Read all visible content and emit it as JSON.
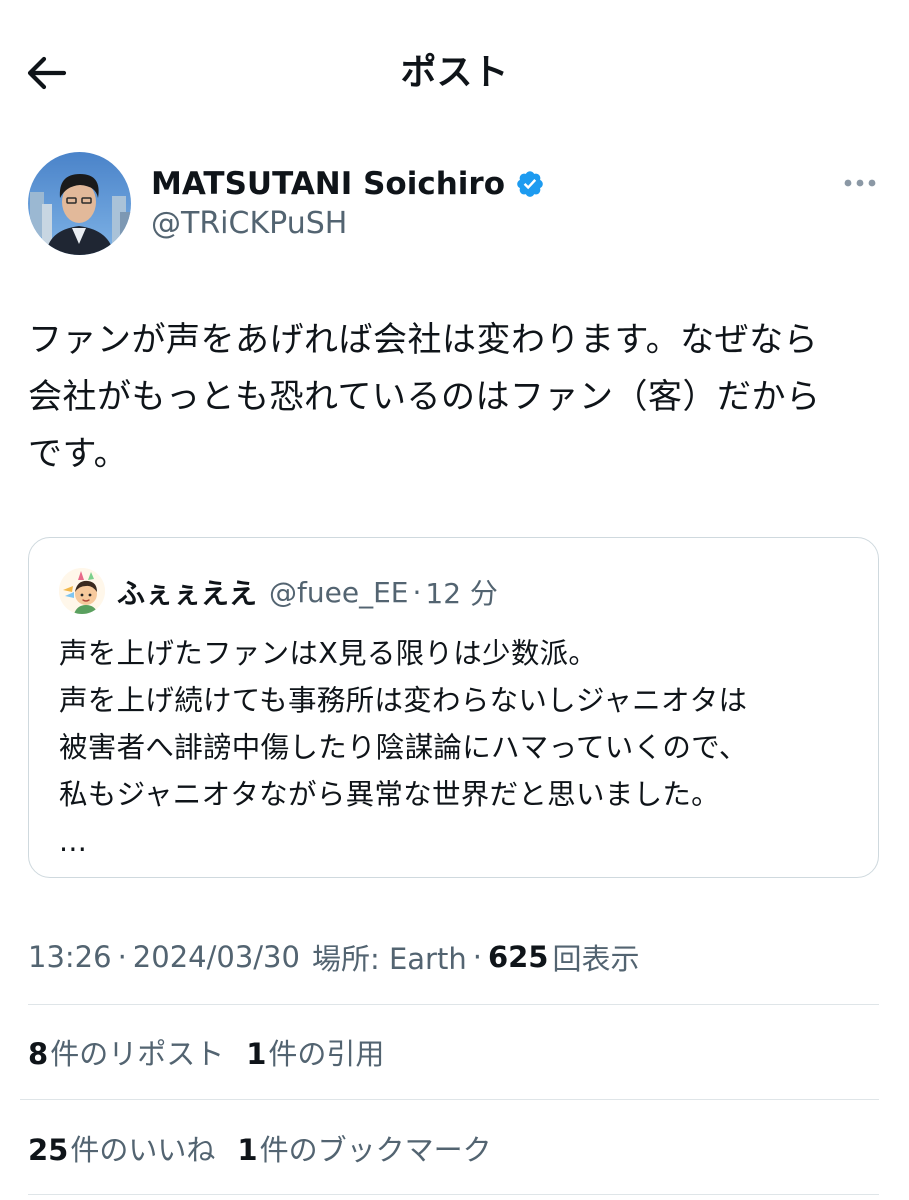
{
  "header": {
    "title": "ポスト"
  },
  "post": {
    "author_name": "MATSUTANI Soichiro",
    "author_handle": "@TRiCKPuSH",
    "text": "ファンが声をあげれば会社は変わります。なぜなら\n会社がもっとも恐れているのはファン（客）だから\nです。"
  },
  "quote": {
    "name": "ふぇぇええ",
    "handle": "@fuee_EE",
    "separator": "·",
    "time": "12 分",
    "text": "声を上げたファンはX見る限りは少数派。\n声を上げ続けても事務所は変わらないしジャニオタは\n被害者へ誹謗中傷したり陰謀論にハマっていくので、\n私もジャニオタながら異常な世界だと思いました。\n..."
  },
  "meta": {
    "time": "13:26",
    "sep1": "·",
    "date": "2024/03/30",
    "location": "場所: Earth",
    "sep2": "·",
    "views_count": "625",
    "views_label": "回表示"
  },
  "stats": {
    "reposts_count": "8",
    "reposts_label": "件のリポスト",
    "quotes_count": "1",
    "quotes_label": "件の引用",
    "likes_count": "25",
    "likes_label": "件のいいね",
    "bookmarks_count": "1",
    "bookmarks_label": "件のブックマーク"
  },
  "colors": {
    "text": "#0f1419",
    "secondary": "#536471",
    "verified": "#1d9bf0",
    "border": "#cfd9de"
  },
  "icons": [
    "back-arrow-icon",
    "verified-badge-icon",
    "more-options-icon"
  ]
}
